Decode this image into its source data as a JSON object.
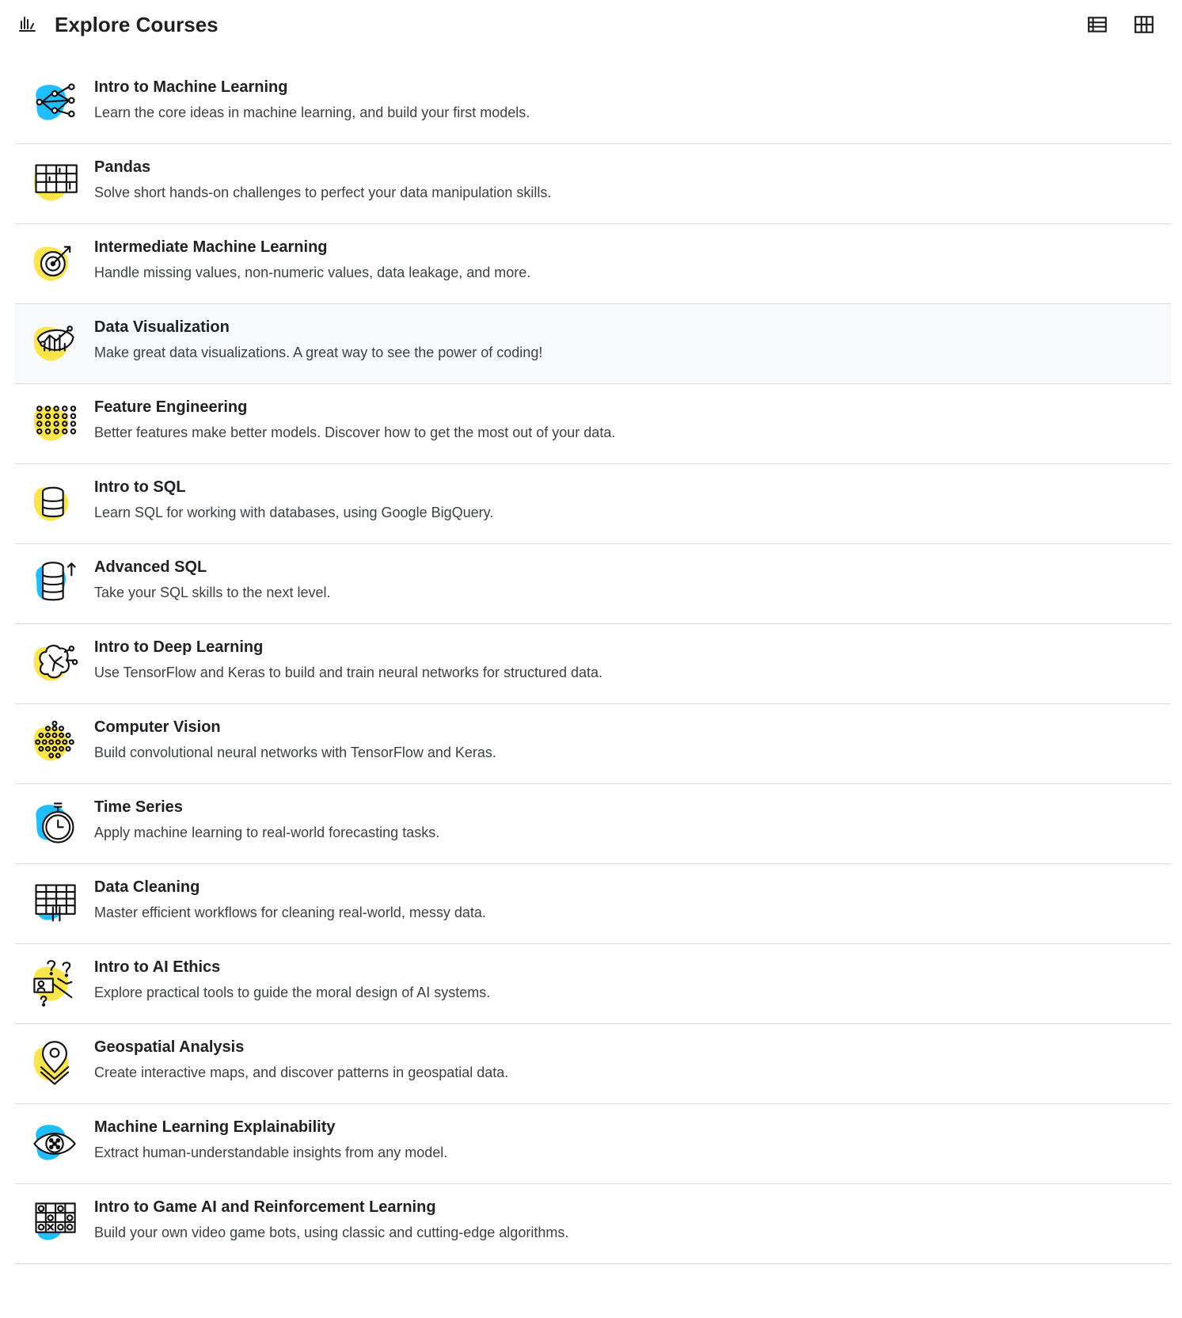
{
  "header": {
    "icon": "bar-chart-icon",
    "title": "Explore Courses",
    "view_list_icon": "list-view-icon",
    "view_grid_icon": "grid-view-icon"
  },
  "colors": {
    "blue_blob": "#20beff",
    "yellow_blob": "#fbe54c",
    "hover_bg": "#f8f9fa",
    "divider": "#dadce0"
  },
  "courses": [
    {
      "title": "Intro to Machine Learning",
      "desc": "Learn the core ideas in machine learning, and build your first models.",
      "icon": "network-nodes-icon",
      "blob": "blue"
    },
    {
      "title": "Pandas",
      "desc": "Solve short hands-on challenges to perfect your data manipulation skills.",
      "icon": "table-grid-icon",
      "blob": "yellow"
    },
    {
      "title": "Intermediate Machine Learning",
      "desc": "Handle missing values, non-numeric values, data leakage, and more.",
      "icon": "target-icon",
      "blob": "yellow"
    },
    {
      "title": "Data Visualization",
      "desc": "Make great data visualizations. A great way to see the power of coding!",
      "icon": "chart-eye-icon",
      "blob": "yellow"
    },
    {
      "title": "Feature Engineering",
      "desc": "Better features make better models. Discover how to get the most out of your data.",
      "icon": "dot-matrix-icon",
      "blob": "yellow"
    },
    {
      "title": "Intro to SQL",
      "desc": "Learn SQL for working with databases, using Google BigQuery.",
      "icon": "database-icon",
      "blob": "yellow"
    },
    {
      "title": "Advanced SQL",
      "desc": "Take your SQL skills to the next level.",
      "icon": "database-up-icon",
      "blob": "blue"
    },
    {
      "title": "Intro to Deep Learning",
      "desc": "Use TensorFlow and Keras to build and train neural networks for structured data.",
      "icon": "brain-circuit-icon",
      "blob": "yellow"
    },
    {
      "title": "Computer Vision",
      "desc": "Build convolutional neural networks with TensorFlow and Keras.",
      "icon": "pixel-dots-icon",
      "blob": "yellow"
    },
    {
      "title": "Time Series",
      "desc": "Apply machine learning to real-world forecasting tasks.",
      "icon": "stopwatch-icon",
      "blob": "blue"
    },
    {
      "title": "Data Cleaning",
      "desc": "Master efficient workflows for cleaning real-world, messy data.",
      "icon": "spreadsheet-icon",
      "blob": "blue"
    },
    {
      "title": "Intro to AI Ethics",
      "desc": "Explore practical tools to guide the moral design of AI systems.",
      "icon": "ethics-question-icon",
      "blob": "yellow"
    },
    {
      "title": "Geospatial Analysis",
      "desc": "Create interactive maps, and discover patterns in geospatial data.",
      "icon": "map-pin-icon",
      "blob": "yellow"
    },
    {
      "title": "Machine Learning Explainability",
      "desc": "Extract human-understandable insights from any model.",
      "icon": "eye-network-icon",
      "blob": "blue"
    },
    {
      "title": "Intro to Game AI and Reinforcement Learning",
      "desc": "Build your own video game bots, using classic and cutting-edge algorithms.",
      "icon": "game-board-icon",
      "blob": "blue"
    }
  ]
}
